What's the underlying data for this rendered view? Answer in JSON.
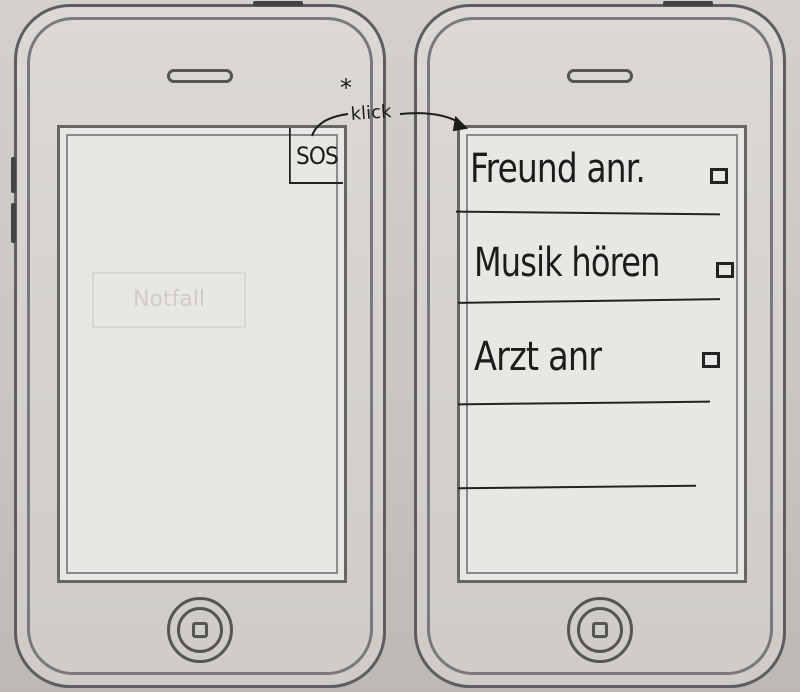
{
  "mockups": [
    {
      "id": "home",
      "sos_label": "SOS",
      "ghost_label": "Notfall"
    },
    {
      "id": "sos-menu",
      "items": [
        {
          "label": "Freund anr."
        },
        {
          "label": "Musik hören"
        },
        {
          "label": "Arzt anr"
        }
      ]
    }
  ],
  "annotation": {
    "star": "*",
    "text": "klick"
  }
}
